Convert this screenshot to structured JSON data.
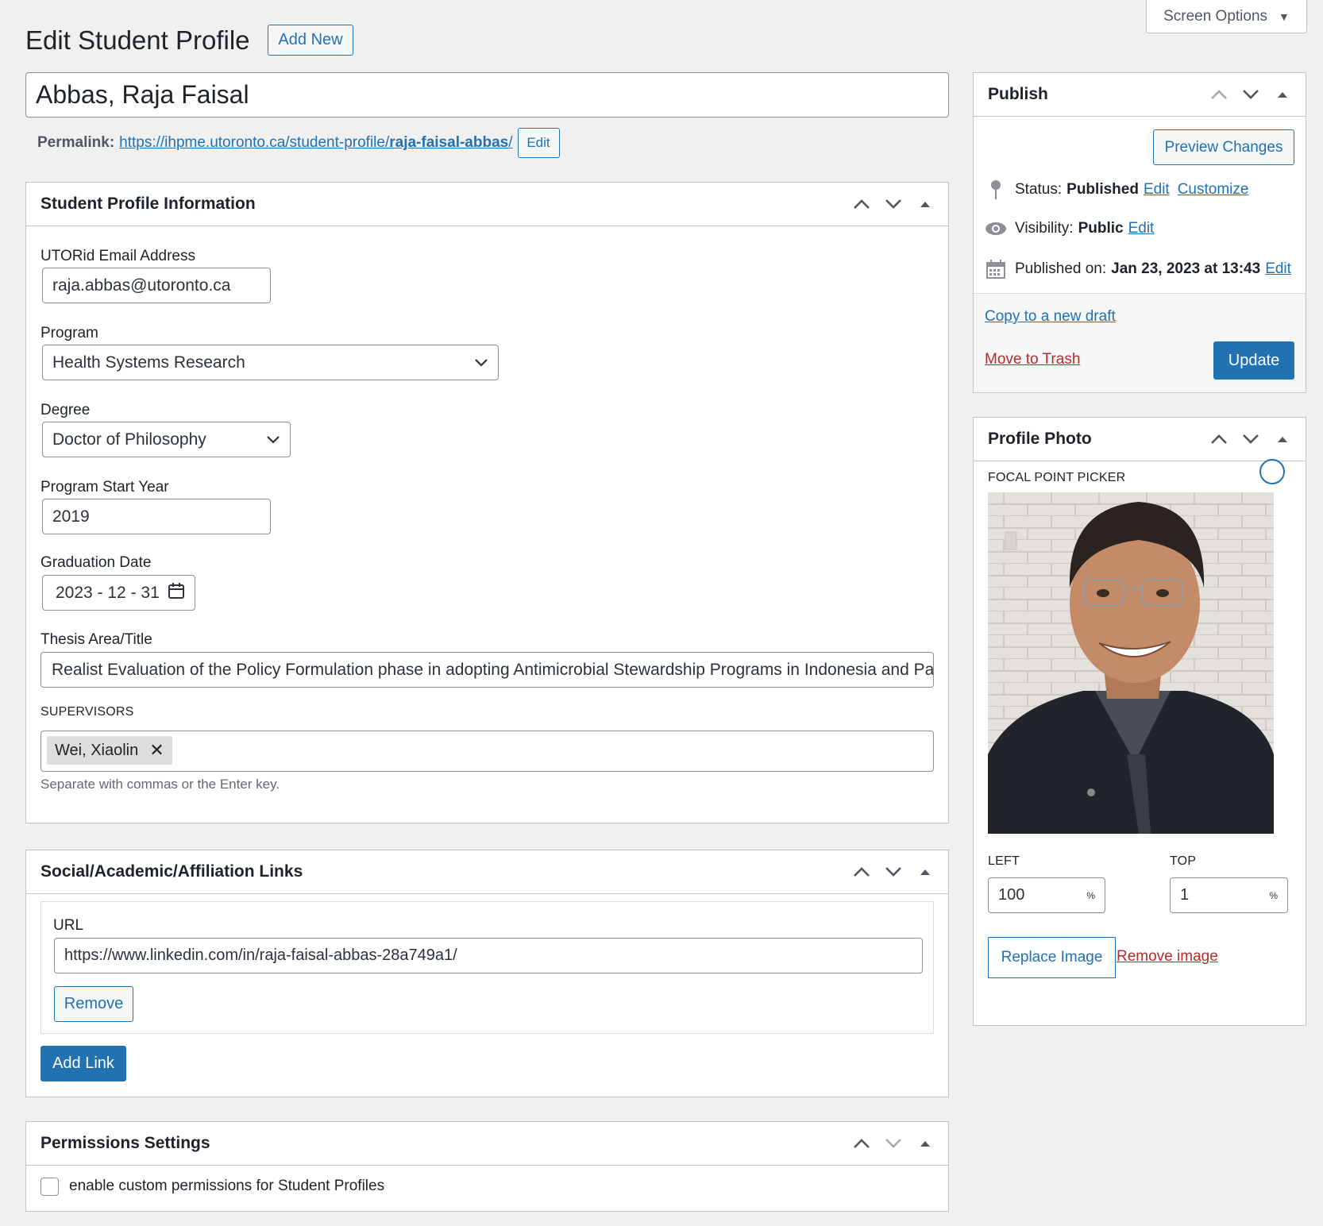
{
  "screen_options": {
    "label": "Screen Options",
    "arrow": "▼"
  },
  "page": {
    "title": "Edit Student Profile",
    "add_new": "Add New"
  },
  "post": {
    "title": "Abbas, Raja Faisal",
    "permalink_label": "Permalink:",
    "permalink_base": "https://ihpme.utoronto.ca/student-profile/",
    "permalink_slug": "raja-faisal-abbas",
    "permalink_trail": "/",
    "permalink_edit": "Edit"
  },
  "student_info": {
    "heading": "Student Profile Information",
    "email_label": "UTORid Email Address",
    "email_value": "raja.abbas@utoronto.ca",
    "program_label": "Program",
    "program_value": "Health Systems Research",
    "degree_label": "Degree",
    "degree_value": "Doctor of Philosophy",
    "start_year_label": "Program Start Year",
    "start_year_value": "2019",
    "grad_label": "Graduation Date",
    "grad_value": "2023 - 12 - 31",
    "thesis_label": "Thesis Area/Title",
    "thesis_value": "Realist Evaluation of the Policy Formulation phase in adopting Antimicrobial Stewardship Programs in Indonesia and Pa",
    "supervisors_label": "SUPERVISORS",
    "supervisors": [
      {
        "name": "Wei, Xiaolin",
        "remove": "✕"
      }
    ],
    "supervisors_help": "Separate with commas or the Enter key."
  },
  "links": {
    "heading": "Social/Academic/Affiliation Links",
    "url_label": "URL",
    "url_value": "https://www.linkedin.com/in/raja-faisal-abbas-28a749a1/",
    "remove": "Remove",
    "add_link": "Add Link"
  },
  "permissions": {
    "heading": "Permissions Settings",
    "checkbox_label": "enable custom permissions for Student Profiles",
    "checked": false
  },
  "publish": {
    "heading": "Publish",
    "preview": "Preview Changes",
    "status_label": "Status:",
    "status_value": "Published",
    "status_edit": "Edit",
    "customize": "Customize",
    "visibility_label": "Visibility:",
    "visibility_value": "Public",
    "visibility_edit": "Edit",
    "published_label": "Published on:",
    "published_value": "Jan 23, 2023 at 13:43",
    "published_edit": "Edit",
    "copy_draft": "Copy to a new draft",
    "trash": "Move to Trash",
    "update": "Update"
  },
  "profile_photo": {
    "heading": "Profile Photo",
    "picker_label": "FOCAL POINT PICKER",
    "left_label": "LEFT",
    "left_value": "100",
    "top_label": "TOP",
    "top_value": "1",
    "unit": "%",
    "replace": "Replace Image",
    "remove": "Remove image"
  },
  "colors": {
    "accent": "#2271b1",
    "danger": "#b32d2e",
    "background": "#f0f0f1"
  }
}
